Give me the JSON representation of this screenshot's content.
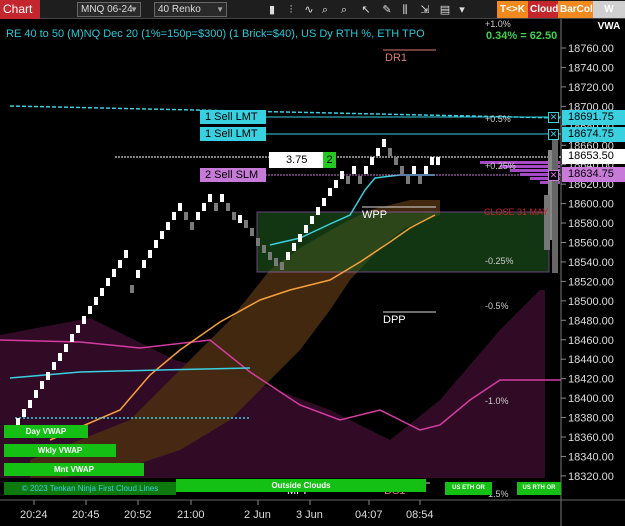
{
  "toolbar": {
    "title": "Chart",
    "instrument": "MNQ 06-24",
    "period": "40 Renko",
    "icons": [
      "bars-icon",
      "bars-type-icon",
      "indicator-icon",
      "zoom-in-icon",
      "zoom-out-icon",
      "cursor-icon",
      "draw-icon",
      "properties-icon",
      "strategy-icon",
      "order-panel-icon"
    ],
    "tk_label": "T<>K",
    "cloud_label": "Cloud",
    "barcol_label": "BarCol",
    "vwap_label": "W VWA"
  },
  "header_text": "RE 40 to 50 (M)NQ Dec 20 (1%=150p=$300) (1 Brick=$40), US Dy RTH %, ETH TPO",
  "pct_label": "0.34% = 62.50",
  "top_pct": "+1.0%",
  "price_axis": {
    "ticks": [
      "18760.00",
      "18740.00",
      "18720.00",
      "18700.00",
      "18680.00",
      "18660.00",
      "18640.00",
      "18620.00",
      "18600.00",
      "18580.00",
      "18560.00",
      "18540.00",
      "18520.00",
      "18500.00",
      "18480.00",
      "18460.00",
      "18440.00",
      "18420.00",
      "18400.00",
      "18380.00",
      "18360.00",
      "18340.00",
      "18320.00"
    ],
    "flags": [
      {
        "label": "18691.75",
        "color": "#39d0e0"
      },
      {
        "label": "18674.75",
        "color": "#39d0e0"
      },
      {
        "label": "18653.50",
        "color": "#ffffff"
      },
      {
        "label": "18634.75",
        "color": "#c77ad8"
      }
    ]
  },
  "time_axis": [
    "20:24",
    "20:45",
    "20:52",
    "21:00",
    "2 Jun",
    "3 Jun",
    "04:07",
    "08:54"
  ],
  "orders": [
    {
      "label": "1 Sell LMT",
      "color": "#39d0e0"
    },
    {
      "label": "1 Sell LMT",
      "color": "#39d0e0"
    },
    {
      "label": "2 Sell SLM",
      "color": "#c77ad8"
    }
  ],
  "qty_value": "3.75",
  "qty_count": "2",
  "levels": {
    "dr1": "DR1",
    "wpp": "WPP",
    "dpp": "DPP",
    "mpp": "MPP",
    "ds1": "DS1",
    "close": "CLOSE 31 MAY",
    "p05": "+0.5%",
    "p025": "+0.25%",
    "m025": "-0.25%",
    "m05": "-0.5%",
    "m10": "-1.0%",
    "m15": "-1.5%"
  },
  "green_bars": {
    "day_vwap": "Day VWAP",
    "wkly_vwap": "Wkly VWAP",
    "mnt_vwap": "Mnt VWAP",
    "copyright": "© 2023 Tenkan Ninja First Cloud Lines",
    "outside_clouds": "Outside Clouds",
    "us_eth_or": "US ETH OR",
    "us_rth_or": "US RTH OR"
  },
  "colors": {
    "accent_red": "#c4262e",
    "cyan": "#39d0e0",
    "magenta": "#c77ad8",
    "green": "#13c013",
    "orange": "#f5a03a",
    "pink": "#d43ca0"
  }
}
